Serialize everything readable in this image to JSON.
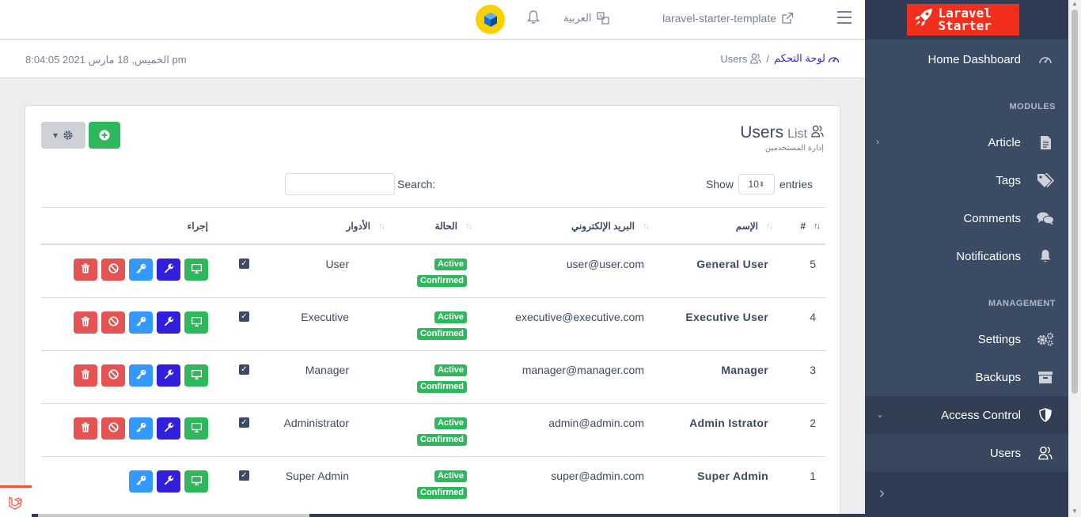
{
  "header": {
    "site_link": "laravel-starter-template",
    "language": "العربية"
  },
  "sidebar": {
    "brand_line1": "Laravel",
    "brand_line2": "Starter",
    "dashboard": "Home Dashboard",
    "modules_title": "MODULES",
    "article": "Article",
    "tags": "Tags",
    "comments": "Comments",
    "notifications": "Notifications",
    "management_title": "MANAGEMENT",
    "settings": "Settings",
    "backups": "Backups",
    "access_control": "Access Control",
    "users": "Users"
  },
  "subheader": {
    "datetime": "الخميس, 18 مارس 2021 8:04:05 pm",
    "breadcrumb_home": "لوحة التحكم",
    "breadcrumb_current": "Users"
  },
  "card": {
    "title": "Users",
    "title_small": "List",
    "subtitle": "إدارة المستخدمين",
    "show_label": "Show",
    "entries_value": "10",
    "entries_label": "entries",
    "search_label": "Search:"
  },
  "table": {
    "headers": {
      "id": "#",
      "name": "الإسم",
      "email": "البريد الإلكتروني",
      "status": "الحالة",
      "roles": "الأدوار",
      "action": "إجراء"
    },
    "status_active": "Active",
    "status_confirmed": "Confirmed",
    "rows": [
      {
        "id": "5",
        "name": "General User",
        "email": "user@user.com",
        "role": "User"
      },
      {
        "id": "4",
        "name": "Executive User",
        "email": "executive@executive.com",
        "role": "Executive"
      },
      {
        "id": "3",
        "name": "Manager",
        "email": "manager@manager.com",
        "role": "Manager"
      },
      {
        "id": "2",
        "name": "Admin Istrator",
        "email": "admin@admin.com",
        "role": "Administrator"
      },
      {
        "id": "1",
        "name": "Super Admin",
        "email": "super@admin.com",
        "role": "Super Admin"
      }
    ]
  },
  "colors": {
    "sidebar": "#3c4b64",
    "brand": "#f22e1c",
    "success": "#2eb85c",
    "primary": "#321fdb",
    "info": "#3399ff",
    "danger": "#e55353"
  }
}
